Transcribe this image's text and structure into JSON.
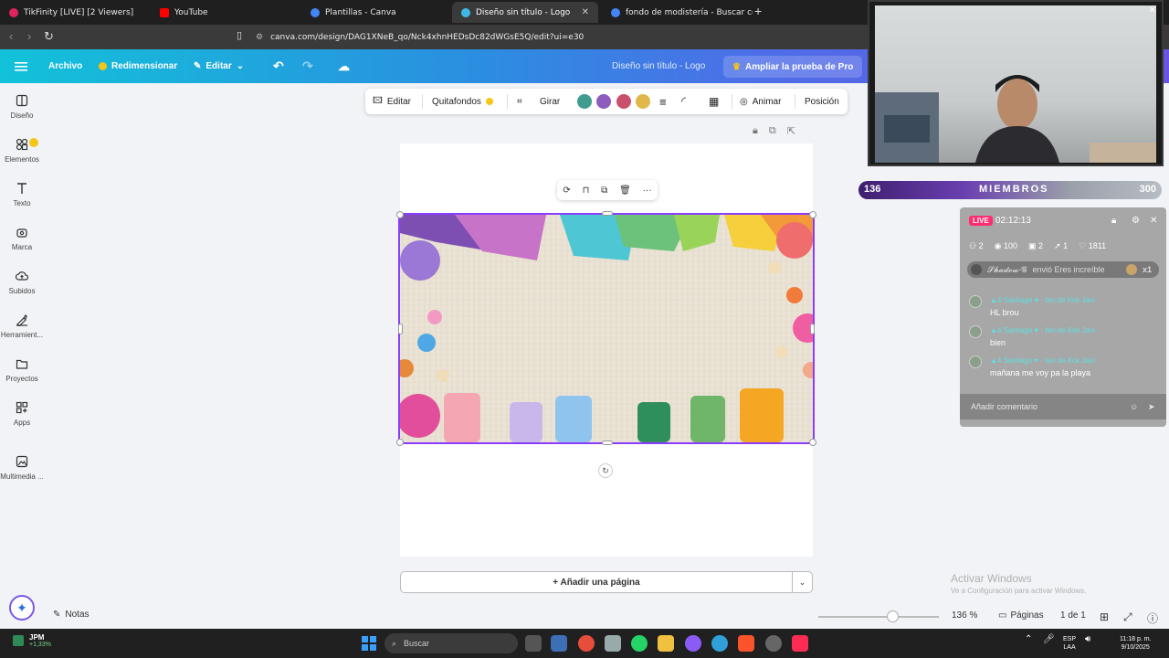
{
  "browser": {
    "tabs": [
      {
        "label": "TikFinity [LIVE] [2 Viewers]",
        "icon": "tikfinity-icon",
        "color": "#e0245e"
      },
      {
        "label": "YouTube",
        "icon": "youtube-icon",
        "color": "#ff0000"
      },
      {
        "label": "Plantillas - Canva",
        "icon": "globe-icon",
        "color": "#4285f4"
      },
      {
        "label": "Diseño sin título - Logo",
        "icon": "canva-icon",
        "color": "#3fb8e6"
      },
      {
        "label": "fondo de modistería - Buscar con Go",
        "icon": "globe-icon",
        "color": "#4285f4"
      }
    ],
    "url": "canva.com/design/DAG1XNeB_qo/Nck4xhnHEDsDc82dWGsE5Q/edit?ui=e30"
  },
  "header": {
    "archivo": "Archivo",
    "redimensionar": "Redimensionar",
    "editar": "Editar",
    "doc_title": "Diseño sin título - Logo",
    "pro_button": "Ampliar la prueba de Pro"
  },
  "sidebar": {
    "items": [
      {
        "label": "Diseño",
        "icon": "design-icon"
      },
      {
        "label": "Elementos",
        "icon": "elements-icon"
      },
      {
        "label": "Texto",
        "icon": "text-icon"
      },
      {
        "label": "Marca",
        "icon": "brand-icon"
      },
      {
        "label": "Subidos",
        "icon": "upload-cloud-icon"
      },
      {
        "label": "Herramient...",
        "icon": "tools-icon"
      },
      {
        "label": "Proyectos",
        "icon": "folder-icon"
      },
      {
        "label": "Apps",
        "icon": "apps-icon"
      },
      {
        "label": "Multimedia ...",
        "icon": "media-icon"
      }
    ]
  },
  "toolbar": {
    "editar": "Editar",
    "quitafondos": "Quitafondos",
    "girar": "Girar",
    "swatches": [
      "#3f9c8f",
      "#8e5bbf",
      "#c9506a",
      "#e0b84a"
    ],
    "animar": "Animar",
    "posicion": "Posición"
  },
  "canvas": {
    "add_page": "+ Añadir una página"
  },
  "statusbar": {
    "notes": "Notas",
    "zoom_level": 0.62,
    "zoom": "136 %",
    "pages": "Páginas",
    "page_count": "1 de 1",
    "watermark_title": "Activar Windows",
    "watermark_sub": "Ve a Configuración para activar Windows."
  },
  "stream": {
    "members_left": "136",
    "members_label": "MIEMBROS",
    "members_right": "300"
  },
  "chat": {
    "live": "LIVE",
    "time": "02:12:13",
    "stats": [
      "2",
      "100",
      "2",
      "1",
      "1811"
    ],
    "gift_name": "𝓢𝓱𝓪𝓭𝓸𝔀-𝓖",
    "gift_text": "envió Eres increíble",
    "gift_count": "x1",
    "messages": [
      {
        "name": "Santiago",
        "badge": "4",
        "fan": "fan de Kok Javi",
        "text": "HL brou"
      },
      {
        "name": "Santiago",
        "badge": "4",
        "fan": "fan de Kok Javi",
        "text": "bien"
      },
      {
        "name": "Santiago",
        "badge": "4",
        "fan": "fan de Kok Javi",
        "text": "mañana me voy pa la playa"
      }
    ],
    "comment_placeholder": "Añadir comentario"
  },
  "taskbar": {
    "weather_title": "JPM",
    "weather_change": "+1,33%",
    "search": "Buscar",
    "lang1": "ESP",
    "lang2": "LAA",
    "time": "11:18 p. m.",
    "date": "9/10/2025"
  }
}
